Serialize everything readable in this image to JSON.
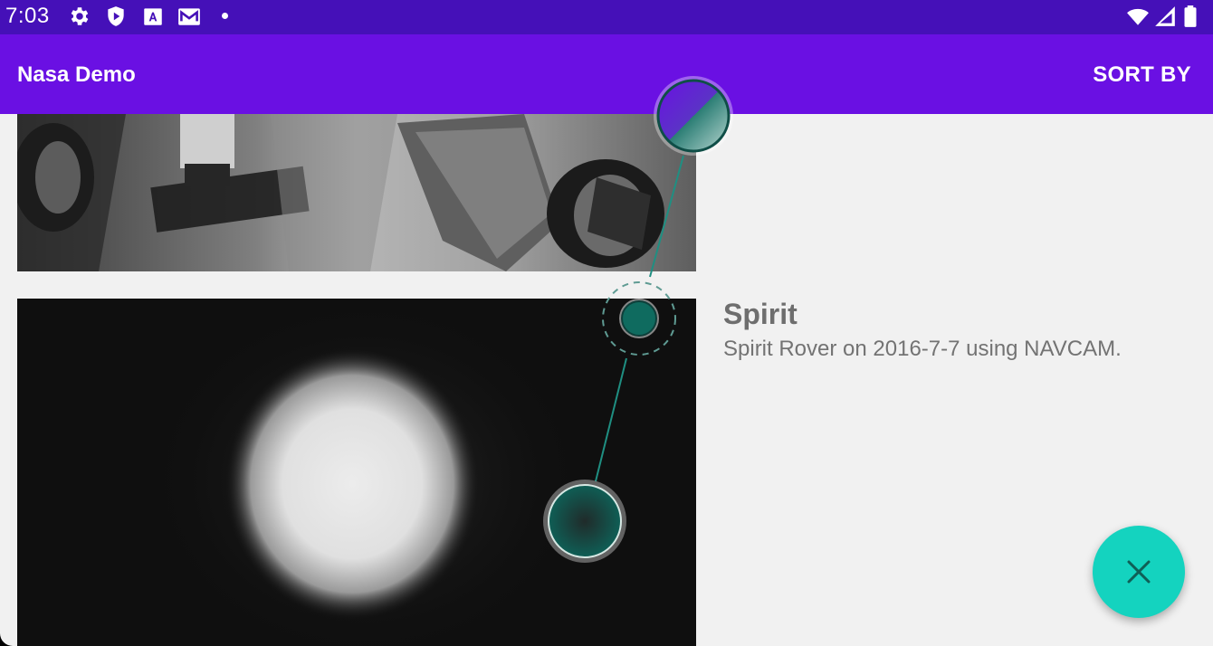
{
  "status_bar": {
    "time": "7:03",
    "icons": [
      "settings-icon",
      "shield-icon",
      "text-a-icon",
      "gmail-icon",
      "dot-icon",
      "wifi-icon",
      "signal-icon",
      "battery-icon"
    ]
  },
  "app_bar": {
    "title": "Nasa Demo",
    "sort_label": "SORT BY"
  },
  "items": [
    {
      "title": "Spirit",
      "subtitle": "Spirit Rover on 2016-7-7 using NAVCAM."
    }
  ],
  "fab": {
    "icon": "close-icon"
  },
  "colors": {
    "status_bar": "#4510b8",
    "app_bar": "#6a10e3",
    "accent": "#14d3bf",
    "touch_teal": "#0f6b5f"
  }
}
